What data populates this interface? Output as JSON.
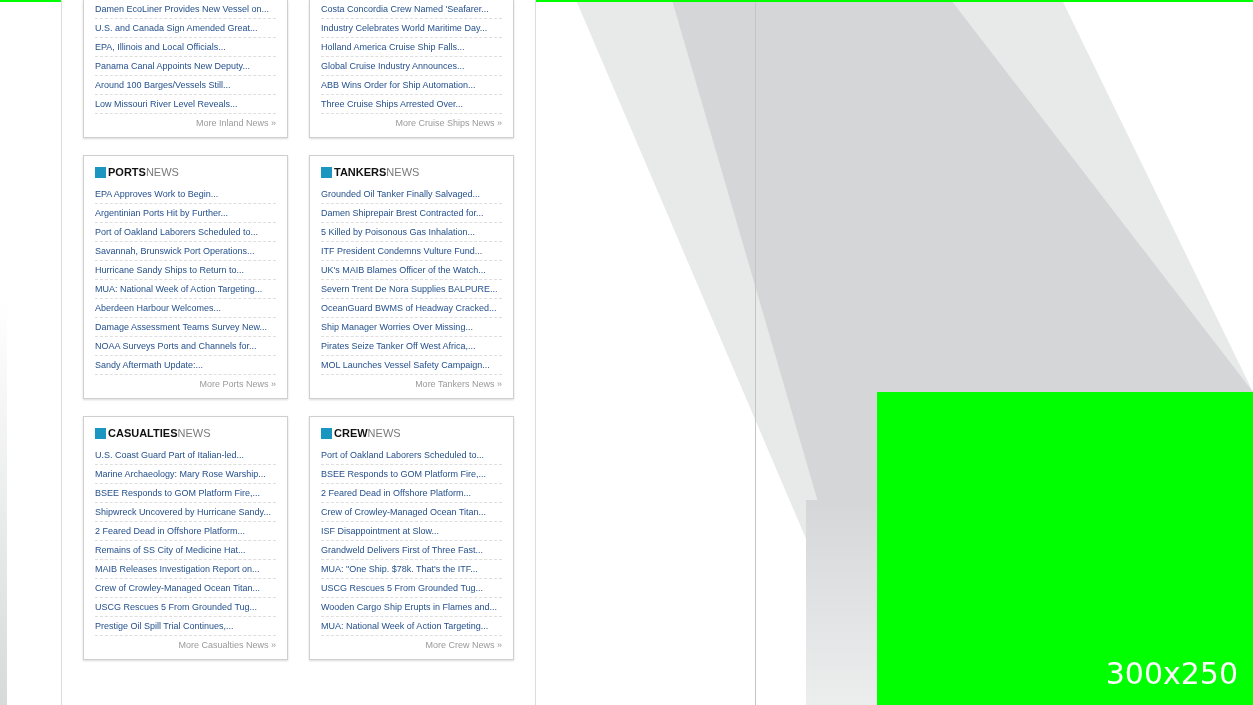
{
  "sections": [
    {
      "items": [
        "Damen EcoLiner Provides New Vessel on...",
        "U.S. and Canada Sign Amended Great...",
        "EPA, Illinois and Local Officials...",
        "Panama Canal Appoints New Deputy...",
        "Around 100 Barges/Vessels Still...",
        "Low Missouri River Level Reveals..."
      ],
      "more": "More Inland News »"
    },
    {
      "items": [
        "Costa Concordia Crew Named 'Seafarer...",
        "Industry Celebrates World Maritime Day...",
        "Holland America Cruise Ship Falls...",
        "Global Cruise Industry Announces...",
        "ABB Wins Order for Ship Automation...",
        "Three Cruise Ships Arrested Over..."
      ],
      "more": "More Cruise Ships News »"
    },
    {
      "heading": "**PORTS**NEWS",
      "items": [
        "EPA Approves Work to Begin...",
        "Argentinian Ports Hit by Further...",
        "Port of Oakland Laborers Scheduled to...",
        "Savannah, Brunswick Port Operations...",
        "Hurricane Sandy Ships to Return to...",
        "MUA: National Week of Action Targeting...",
        "Aberdeen Harbour Welcomes...",
        "Damage Assessment Teams Survey New...",
        "NOAA Surveys Ports and Channels for...",
        "Sandy Aftermath Update:..."
      ],
      "more": "More Ports News »"
    },
    {
      "heading": "**TANKERS**NEWS",
      "items": [
        "Grounded Oil Tanker Finally Salvaged...",
        "Damen Shiprepair Brest Contracted for...",
        "5 Killed by Poisonous Gas Inhalation...",
        "ITF President Condemns Vulture Fund...",
        "UK's MAIB Blames Officer of the Watch...",
        "Severn Trent De Nora Supplies BALPURE...",
        "OceanGuard BWMS of Headway Cracked...",
        "Ship Manager Worries Over Missing...",
        "Pirates Seize Tanker Off West Africa,...",
        "MOL Launches Vessel Safety Campaign..."
      ],
      "more": "More Tankers News »"
    },
    {
      "heading": "**CASUALTIES**NEWS",
      "items": [
        "U.S. Coast Guard Part of Italian-led...",
        "Marine Archaeology: Mary Rose Warship...",
        "BSEE Responds to GOM Platform Fire,...",
        "Shipwreck Uncovered by Hurricane Sandy...",
        "2 Feared Dead in Offshore Platform...",
        "Remains of SS City of Medicine Hat...",
        "MAIB Releases Investigation Report on...",
        "Crew of Crowley-Managed Ocean Titan...",
        "USCG Rescues 5 From Grounded Tug...",
        "Prestige Oil Spill Trial Continues,..."
      ],
      "more": "More Casualties News »"
    },
    {
      "heading": "**CREW**NEWS",
      "items": [
        "Port of Oakland Laborers Scheduled to...",
        "BSEE Responds to GOM Platform Fire,...",
        "2 Feared Dead in Offshore Platform...",
        "Crew of Crowley-Managed Ocean Titan...",
        "ISF Disappointment at Slow...",
        "Grandweld Delivers First of Three Fast...",
        "MUA: \"One Ship. $78k. That's the ITF...",
        "USCG Rescues 5 From Grounded Tug...",
        "Wooden Cargo Ship Erupts in Flames and...",
        "MUA: National Week of Action Targeting..."
      ],
      "more": "More Crew News »"
    }
  ],
  "ad": {
    "label": "300x250"
  }
}
